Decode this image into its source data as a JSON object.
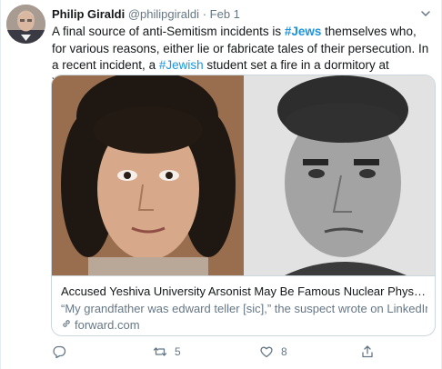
{
  "tweet": {
    "author_name": "Philip Giraldi",
    "author_handle": "@philipgiraldi",
    "separator": "·",
    "date": "Feb 1",
    "text": {
      "part1": "A final source of anti-Semitism incidents is ",
      "tag1": "#Jews",
      "part2": " themselves who, for various reasons, either lie or fabricate tales of their persecution. In a recent incident, a ",
      "tag2": "#Jewish",
      "part3": " student set a fire in a dormitory at Yeshiva University."
    },
    "card": {
      "title": "Accused Yeshiva University Arsonist May Be Famous Nuclear Physicist's ...",
      "description": "“My grandfather was edward teller [sic],” the suspect wrote on LinkedIn.",
      "domain": "forward.com"
    },
    "actions": {
      "reply_count": "",
      "retweet_count": "5",
      "like_count": "8"
    },
    "colors": {
      "link": "#1b95e0",
      "muted": "#657786",
      "border": "#ccd6dd"
    },
    "icons": [
      "chevron-down-icon",
      "reply-icon",
      "retweet-icon",
      "like-icon",
      "share-icon",
      "link-icon"
    ]
  }
}
